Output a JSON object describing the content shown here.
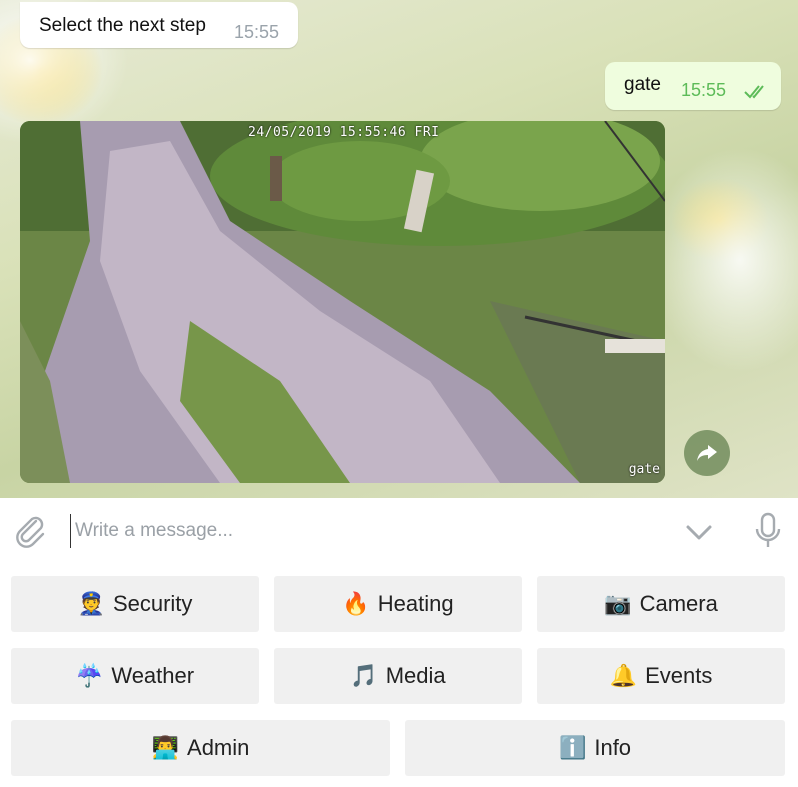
{
  "messages": {
    "incoming": {
      "text": "Select the next step",
      "time": "15:55"
    },
    "outgoing": {
      "text": "gate",
      "time": "15:55",
      "status_icon": "double-check-icon"
    },
    "photo": {
      "timestamp": "24/05/2019 15:55:46 FRI",
      "camera_label": "gate",
      "forward_icon": "forward-arrow-icon"
    }
  },
  "composer": {
    "placeholder": "Write a message...",
    "attach_icon": "paperclip-icon",
    "keyboard_toggle_icon": "chevron-down-icon",
    "voice_icon": "microphone-icon"
  },
  "keyboard": {
    "rows": [
      [
        {
          "emoji": "👮",
          "label": "Security"
        },
        {
          "emoji": "🔥",
          "label": "Heating"
        },
        {
          "emoji": "📷",
          "label": "Camera"
        }
      ],
      [
        {
          "emoji": "☔",
          "label": "Weather"
        },
        {
          "emoji": "🎵",
          "label": "Media"
        },
        {
          "emoji": "🔔",
          "label": "Events"
        }
      ],
      [
        {
          "emoji": "👨‍💻",
          "label": "Admin"
        },
        {
          "emoji": "ℹ️",
          "label": "Info"
        }
      ]
    ]
  },
  "colors": {
    "outgoing_bubble": "#effdde",
    "outgoing_time": "#5dbb58",
    "incoming_time": "#9aa3ab",
    "keyboard_button": "#f0f0f0"
  }
}
